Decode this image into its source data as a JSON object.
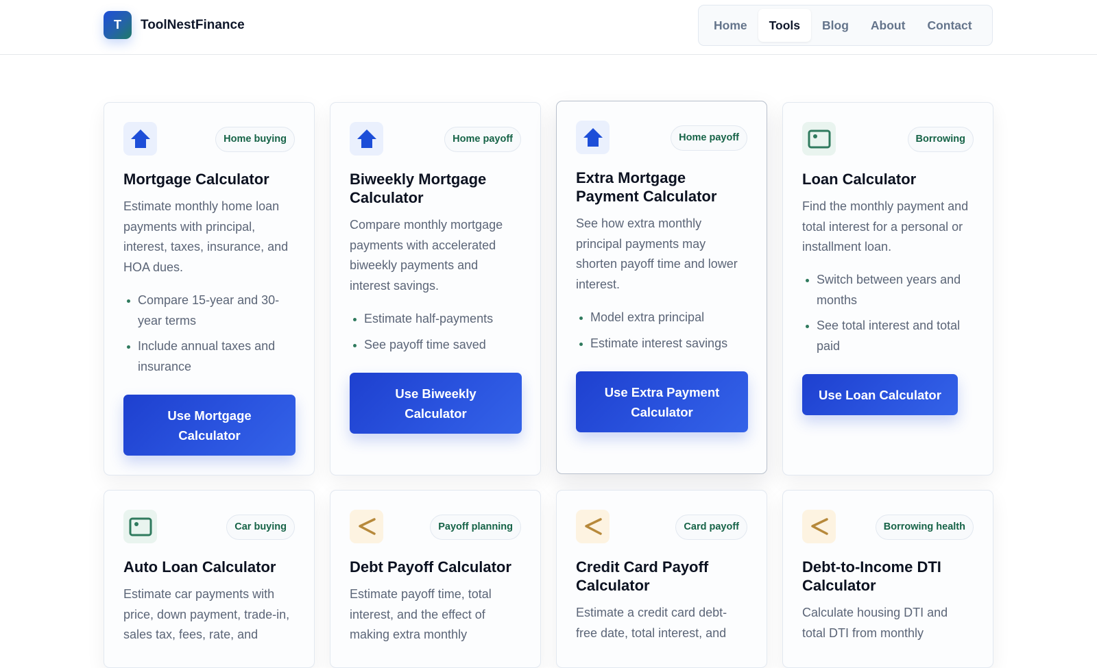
{
  "brand": {
    "logo_letter": "T",
    "name": "ToolNestFinance"
  },
  "nav": {
    "items": [
      "Home",
      "Tools",
      "Blog",
      "About",
      "Contact"
    ],
    "active": "Tools"
  },
  "colors": {
    "primary": "#2b55e0",
    "tag_text": "#166347",
    "bullet": "#2f7a5e",
    "home_icon": "#1d4ed8",
    "wallet_icon": "#2f7a5e",
    "chevron_icon": "#b7893b"
  },
  "cards": [
    {
      "icon": "house-icon",
      "tag": "Home buying",
      "title": "Mortgage Calculator",
      "description": "Estimate monthly home loan payments with principal, interest, taxes, insurance, and HOA dues.",
      "bullets": [
        "Compare 15-year and 30-year terms",
        "Include annual taxes and insurance"
      ],
      "button": "Use Mortgage Calculator"
    },
    {
      "icon": "house-icon",
      "tag": "Home payoff",
      "title": "Biweekly Mortgage Calculator",
      "description": "Compare monthly mortgage payments with accelerated biweekly payments and interest savings.",
      "bullets": [
        "Estimate half-payments",
        "See payoff time saved"
      ],
      "button": "Use Biweekly Calculator"
    },
    {
      "icon": "house-icon",
      "tag": "Home payoff",
      "title": "Extra Mortgage Payment Calculator",
      "description": "See how extra monthly principal payments may shorten payoff time and lower interest.",
      "bullets": [
        "Model extra principal",
        "Estimate interest savings"
      ],
      "button": "Use Extra Payment Calculator"
    },
    {
      "icon": "wallet-icon",
      "tag": "Borrowing",
      "title": "Loan Calculator",
      "description": "Find the monthly payment and total interest for a personal or installment loan.",
      "bullets": [
        "Switch between years and months",
        "See total interest and total paid"
      ],
      "button": "Use Loan Calculator"
    },
    {
      "icon": "wallet-icon",
      "tag": "Car buying",
      "title": "Auto Loan Calculator",
      "description": "Estimate car payments with price, down payment, trade-in, sales tax, fees, rate, and"
    },
    {
      "icon": "chevron-left-icon",
      "tag": "Payoff planning",
      "title": "Debt Payoff Calculator",
      "description": "Estimate payoff time, total interest, and the effect of making extra monthly"
    },
    {
      "icon": "chevron-left-icon",
      "tag": "Card payoff",
      "title": "Credit Card Payoff Calculator",
      "description": "Estimate a credit card debt-free date, total interest, and"
    },
    {
      "icon": "chevron-left-icon",
      "tag": "Borrowing health",
      "title": "Debt-to-Income DTI Calculator",
      "description": "Calculate housing DTI and total DTI from monthly"
    }
  ]
}
